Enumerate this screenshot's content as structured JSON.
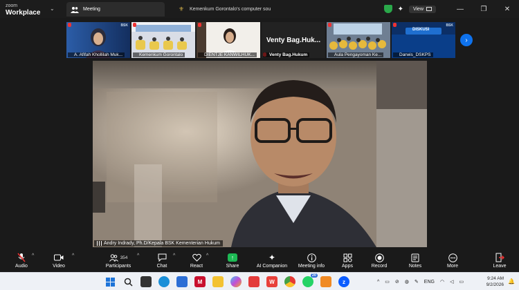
{
  "app": {
    "brand_line1": "zoom",
    "brand_line2": "Workplace",
    "active_tab": "Meeting",
    "other_tab": "Kemenkum Gorontalo's computer sou",
    "view_label": "View"
  },
  "participants": [
    {
      "name": "A. Afifah Khollilah Muk..."
    },
    {
      "name": "Kemenkum Gorontalo"
    },
    {
      "name": "DIENTJE KANWILHUK..."
    },
    {
      "name": "Venty Bag.Hukum",
      "display_name": "Venty  Bag.Huk..."
    },
    {
      "name": "Aula Pengayoman Ke..."
    },
    {
      "name": "Darwis_DSKPS"
    }
  ],
  "thumb_text": {
    "bsk": "BSK",
    "diskusi": "DISKUSI"
  },
  "speaker": {
    "label": "Andry Indrady, Ph.D/Kepala BSK Kementerian Hukum"
  },
  "toolbar": {
    "audio": "Audio",
    "video": "Video",
    "participants": "Participants",
    "participant_count": "354",
    "chat": "Chat",
    "react": "React",
    "share": "Share",
    "ai_companion": "AI Companion",
    "meeting_info": "Meeting info",
    "apps": "Apps",
    "record": "Record",
    "notes": "Notes",
    "more": "More",
    "leave": "Leave"
  },
  "taskbar": {
    "whatsapp_badge": "20",
    "language": "ENG",
    "time": "9:24 AM",
    "date": "9/2/2026"
  },
  "icons": {
    "audio": "mic-muted-icon",
    "video": "camera-icon",
    "participants": "people-icon",
    "chat": "chat-bubble-icon",
    "react": "heart-icon",
    "share": "share-screen-icon",
    "ai_companion": "sparkle-icon",
    "meeting_info": "info-icon",
    "apps": "apps-icon",
    "record": "record-icon",
    "notes": "notes-icon",
    "more": "more-icon",
    "leave": "leave-icon"
  },
  "colors": {
    "accent": "#0e72ed",
    "share": "#1db954",
    "mute": "#e33333",
    "background": "#1a1a1a"
  }
}
